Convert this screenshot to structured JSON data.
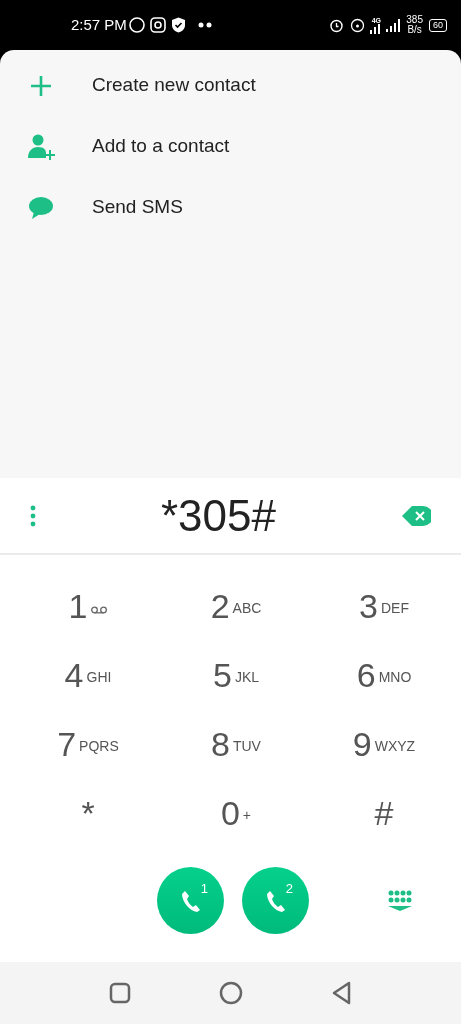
{
  "status_bar": {
    "time": "2:57 PM",
    "network_type": "4G",
    "speed": "385",
    "speed_unit": "B/s",
    "battery": "60"
  },
  "menu": [
    {
      "kind": "add",
      "label": "Create new contact"
    },
    {
      "kind": "person_add",
      "label": "Add to a contact"
    },
    {
      "kind": "message",
      "label": "Send SMS"
    }
  ],
  "dialer": {
    "number": "*305#",
    "keys": [
      {
        "kind": "voicemail",
        "digit": "1"
      },
      {
        "kind": "plain",
        "digit": "2",
        "letters": "ABC"
      },
      {
        "kind": "plain",
        "digit": "3",
        "letters": "DEF"
      },
      {
        "kind": "plain",
        "digit": "4",
        "letters": "GHI"
      },
      {
        "kind": "plain",
        "digit": "5",
        "letters": "JKL"
      },
      {
        "kind": "plain",
        "digit": "6",
        "letters": "MNO"
      },
      {
        "kind": "plain",
        "digit": "7",
        "letters": "PQRS"
      },
      {
        "kind": "plain",
        "digit": "8",
        "letters": "TUV"
      },
      {
        "kind": "plain",
        "digit": "9",
        "letters": "WXYZ"
      },
      {
        "kind": "plain",
        "digit": "*"
      },
      {
        "kind": "plain",
        "digit": "0",
        "letters": "+"
      },
      {
        "kind": "plain",
        "digit": "#"
      }
    ],
    "call_buttons": [
      {
        "sim": "1"
      },
      {
        "sim": "2"
      }
    ]
  }
}
